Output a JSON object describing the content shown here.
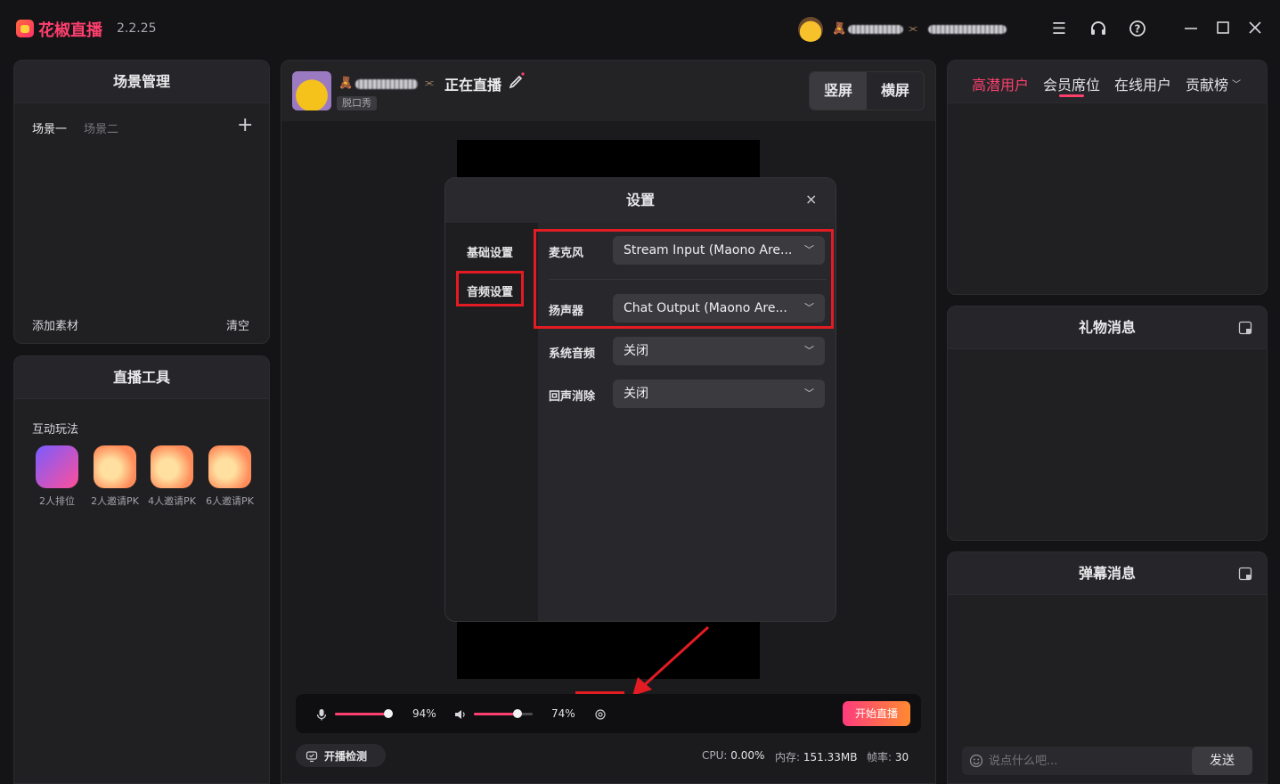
{
  "app": {
    "name": "花椒直播",
    "version": "2.2.25"
  },
  "user": {
    "name": "********",
    "id": "(********)"
  },
  "scene": {
    "title": "场景管理",
    "tabs": [
      "场景一",
      "场景二"
    ],
    "add_material": "添加素材",
    "clear": "清空"
  },
  "tools": {
    "title": "直播工具",
    "section": "互动玩法",
    "items": [
      {
        "label": "2人排位",
        "icon": "ranking-icon"
      },
      {
        "label": "2人邀请PK",
        "icon": "pk-icon"
      },
      {
        "label": "4人邀请PK",
        "icon": "pk-icon"
      },
      {
        "label": "6人邀请PK",
        "icon": "pk-icon"
      }
    ]
  },
  "stream": {
    "status": "正在直播",
    "category": "脱口秀",
    "portrait": "竖屏",
    "landscape": "横屏"
  },
  "settings": {
    "title": "设置",
    "nav": [
      "基础设置",
      "音频设置"
    ],
    "rows": [
      {
        "label": "麦克风",
        "value": "Stream Input (Maono Are..."
      },
      {
        "label": "扬声器",
        "value": "Chat Output (Maono Are..."
      },
      {
        "label": "系统音频",
        "value": "关闭"
      },
      {
        "label": "回声消除",
        "value": "关闭"
      }
    ]
  },
  "controls": {
    "mic_pct": "94%",
    "mic_level": 0.94,
    "speaker_pct": "74%",
    "speaker_level": 0.74,
    "start_label": "开始直播",
    "check_label": "开播检测"
  },
  "stats": {
    "cpu_label": "CPU:",
    "cpu": "0.00%",
    "mem_label": "内存:",
    "mem": "151.33MB",
    "fps_label": "帧率:",
    "fps": "30"
  },
  "right": {
    "tabs": [
      "高潜用户",
      "会员席位",
      "在线用户",
      "贡献榜"
    ],
    "gift_title": "礼物消息",
    "danmaku_title": "弹幕消息",
    "input_placeholder": "说点什么吧...",
    "send_label": "发送"
  },
  "colors": {
    "accent": "#ff3f6e",
    "highlight": "#e31b23"
  }
}
